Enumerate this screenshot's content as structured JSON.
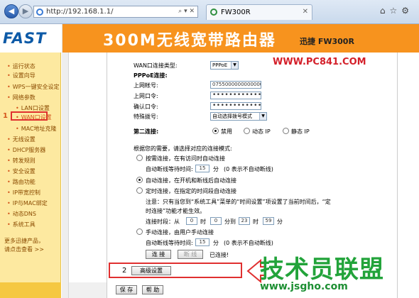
{
  "browser": {
    "url": "http://192.168.1.1/",
    "tab_title": "FW300R",
    "back_icon": "arrow-left-icon",
    "forward_icon": "arrow-right-icon"
  },
  "header": {
    "logo": "FAST",
    "title": "300M无线宽带路由器",
    "model": "迅捷 FW300R",
    "color": "#f7931e"
  },
  "watermark_top": "WWW.PC841.COM",
  "sidebar": {
    "items": [
      "运行状态",
      "设置向导",
      "WPS一键安全设定",
      "网络参数",
      "LAN口设置",
      "WAN口设置",
      "MAC地址克隆",
      "无线设置",
      "DHCP服务器",
      "转发规则",
      "安全设置",
      "路由功能",
      "IP带宽控制",
      "IP与MAC绑定",
      "动态DNS",
      "系统工具"
    ],
    "active_marker": "1",
    "more_line1": "更多迅捷产品，",
    "more_line2": "请点击查看 >>"
  },
  "form": {
    "wan_type_label": "WAN口连接类型:",
    "wan_type_value": "PPPoE",
    "pppoe_label": "PPPoE连接:",
    "account_label": "上网帐号:",
    "account_value": "0755000000000000",
    "password_label": "上网口令:",
    "password_value": "••••••••••••",
    "confirm_label": "确认口令:",
    "confirm_value": "••••••••••••",
    "dial_label": "特殊拨号:",
    "dial_value": "自动选择拨号模式",
    "second_label": "第二连接:",
    "second_options": [
      "禁用",
      "动态 IP",
      "静态 IP"
    ],
    "mode_intro": "根据您的需要，请选择对应的连接模式:",
    "on_demand": "按需连接，在有访问时自动连接",
    "idle_label": "自动断线等待时间:",
    "idle_value": "15",
    "idle_unit": "分",
    "idle_note": "(0 表示不自动断线)",
    "auto_connect": "自动连接，在开机和断线后自动连接",
    "timed_connect": "定时连接，在指定的时间段自动连接",
    "timed_note1": "注意：只有当您到“系统工具”菜单的“时间设置”项设置了当前时间后，“定",
    "timed_note2": "时连接”功能才能生效。",
    "period_label": "连接时段：从",
    "period_from_h": "0",
    "period_h": "时",
    "period_from_m": "0",
    "period_to": "分到",
    "period_to_h": "23",
    "period_to_m": "59",
    "period_m": "分",
    "manual_connect": "手动连接，由用户手动连接",
    "idle2_value": "15",
    "connect_btn": "连 接",
    "disconnect_btn": "断 线",
    "status": "已连接!",
    "advanced_btn": "高级设置",
    "save_btn": "保 存",
    "help_btn": "帮 助",
    "step2_marker": "2"
  },
  "watermark_bottom": {
    "brand": "技术员联盟",
    "site": "www.jsgho.com"
  }
}
